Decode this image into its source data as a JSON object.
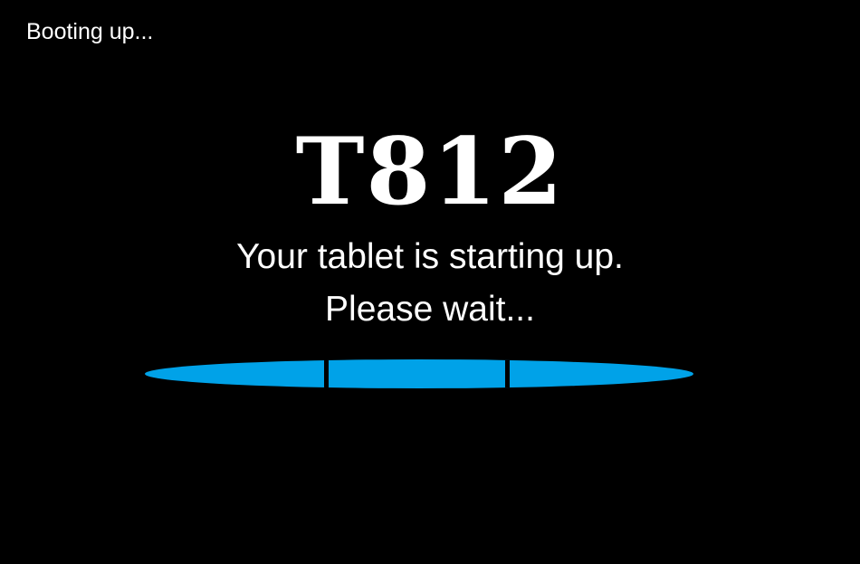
{
  "status_text": "Booting up...",
  "logo_text": "T812",
  "message": {
    "line1": "Your tablet is starting up.",
    "line2": "Please wait..."
  },
  "progress": {
    "fraction": 1.0,
    "segments": 3,
    "color": "#00a2e8"
  },
  "colors": {
    "background": "#000000",
    "text": "#ffffff",
    "accent": "#00a2e8"
  }
}
